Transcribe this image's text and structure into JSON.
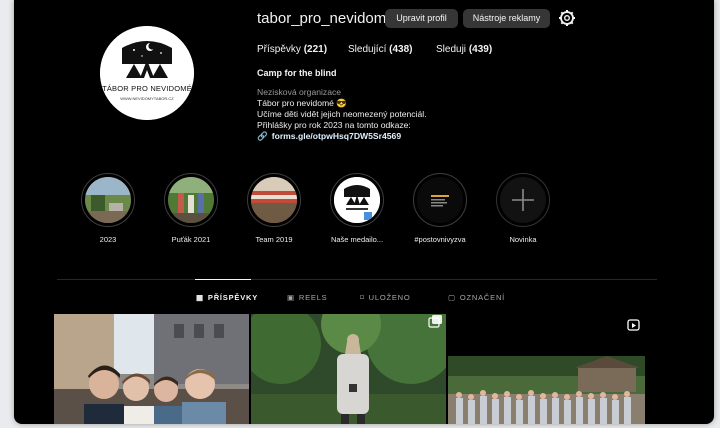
{
  "profile": {
    "username": "tabor_pro_nevidome",
    "edit_label": "Upravit profil",
    "ad_tools_label": "Nástroje reklamy",
    "logo_text": "TÁBOR PRO NEVIDOMÉ",
    "logo_url": "WWW.NEVIDOMYTABOR.CZ"
  },
  "stats": {
    "posts_label": "Příspěvky",
    "posts_count": "(221)",
    "followers_label": "Sledující",
    "followers_count": "(438)",
    "following_label": "Sleduji",
    "following_count": "(439)"
  },
  "bio": {
    "name": "Camp for the blind",
    "category": "Nezisková organizace",
    "line1": "Tábor pro nevidomé 😎",
    "line2": "Učíme děti vidět jejich neomezený potenciál.",
    "line3": "Přihlášky pro rok 2023 na tomto odkaze:",
    "link": "forms.gle/otpwHsq7DW5Sr4569"
  },
  "highlights": [
    {
      "label": "2023"
    },
    {
      "label": "Puťák 2021"
    },
    {
      "label": "Team 2019"
    },
    {
      "label": "Naše medailo..."
    },
    {
      "label": "#postovnivyzva"
    },
    {
      "label": "Novinka"
    }
  ],
  "tabs": [
    {
      "label": "PŘÍSPĚVKY",
      "icon": "grid-icon"
    },
    {
      "label": "REELS",
      "icon": "reels-icon"
    },
    {
      "label": "ULOŽENO",
      "icon": "bookmark-icon"
    },
    {
      "label": "OZNAČENÍ",
      "icon": "tag-icon"
    }
  ],
  "colors": {
    "background": "#000000",
    "button": "#363636",
    "link": "#e0f1ff",
    "muted": "#a8a8a8"
  }
}
